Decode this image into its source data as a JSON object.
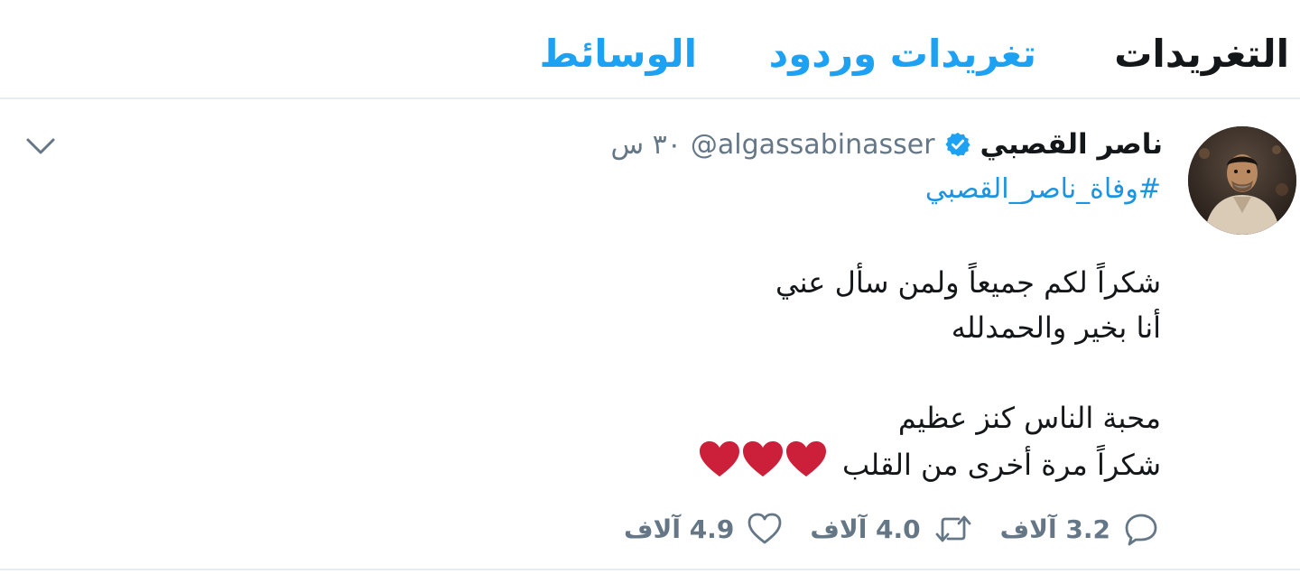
{
  "tabs": {
    "tweets": "التغريدات",
    "tweets_replies": "تغريدات وردود",
    "media": "الوسائط"
  },
  "tweet": {
    "author_name": "ناصر القصبي",
    "handle": "@algassabinasser",
    "time": "٣٠ س",
    "hashtag": "#وفاة_ناصر_القصبي",
    "lines": [
      "شكراً  لكم جميعاً ولمن سأل عني",
      "أنا بخير والحمدلله",
      "محبة الناس كنز عظيم",
      "شكراً مرة أخرى من القلب"
    ],
    "stats": {
      "replies": "3.2 آلاف",
      "retweets": "4.0 آلاف",
      "likes": "4.9 آلاف"
    }
  },
  "colors": {
    "accent": "#1da1f2",
    "link": "#1b95e0",
    "muted": "#657786",
    "heart": "#cc1f3a",
    "divider": "#e6ecf0"
  },
  "icons": [
    "chevron-down-icon",
    "verified-badge-icon",
    "reply-icon",
    "retweet-icon",
    "like-icon",
    "heart-emoji-icon"
  ]
}
